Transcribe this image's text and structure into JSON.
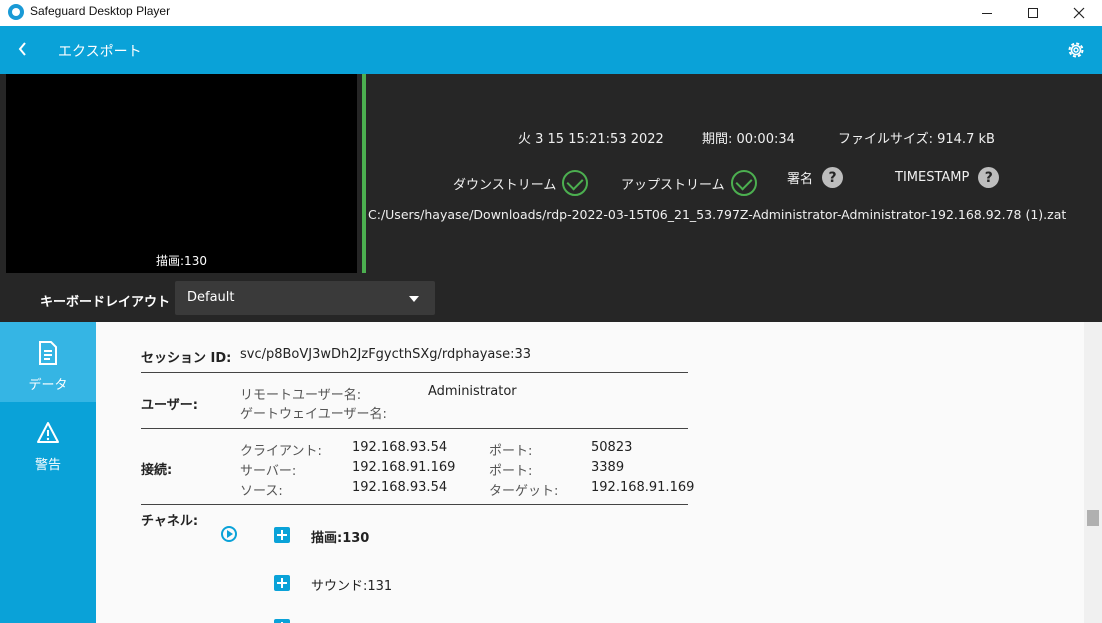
{
  "window": {
    "title": "Safeguard Desktop Player"
  },
  "header": {
    "title": "エクスポート",
    "back_icon": "chevron-left-icon",
    "settings_icon": "gear-icon"
  },
  "preview": {
    "label": "描画:130"
  },
  "summary": {
    "datetime": "火 3 15 15:21:53 2022",
    "duration_label": "期間: 00:00:34",
    "filesize_label": "ファイルサイズ: 914.7 kB",
    "downstream_label": "ダウンストリーム",
    "upstream_label": "アップストリーム",
    "signature_label": "署名",
    "timestamp_label": "TIMESTAMP",
    "help_glyph": "?",
    "file_path": "C:/Users/hayase/Downloads/rdp-2022-03-15T06_21_53.797Z-Administrator-Administrator-192.168.92.78 (1).zat"
  },
  "keyboard": {
    "label": "キーボードレイアウト",
    "selected": "Default"
  },
  "sidenav": {
    "items": [
      {
        "label": "データ",
        "icon": "document-icon",
        "active": true
      },
      {
        "label": "警告",
        "icon": "warning-icon",
        "active": false
      }
    ]
  },
  "details": {
    "session_label": "セッション ID:",
    "session_value": "svc/p8BoVJ3wDh2JzFgycthSXg/rdphayase:33",
    "user_label": "ユーザー:",
    "remote_user_label": "リモートユーザー名:",
    "remote_user_value": "Administrator",
    "gateway_user_label": "ゲートウェイユーザー名:",
    "connection_label": "接続:",
    "client_label": "クライアント:",
    "client_value": "192.168.93.54",
    "client_port_label": "ポート:",
    "client_port_value": "50823",
    "server_label": "サーバー:",
    "server_value": "192.168.91.169",
    "server_port_label": "ポート:",
    "server_port_value": "3389",
    "source_label": "ソース:",
    "source_value": "192.168.93.54",
    "target_label": "ターゲット:",
    "target_value": "192.168.91.169",
    "channels_label": "チャネル:",
    "channels": [
      {
        "label": "描画:130"
      },
      {
        "label": "サウンド:131"
      }
    ]
  }
}
